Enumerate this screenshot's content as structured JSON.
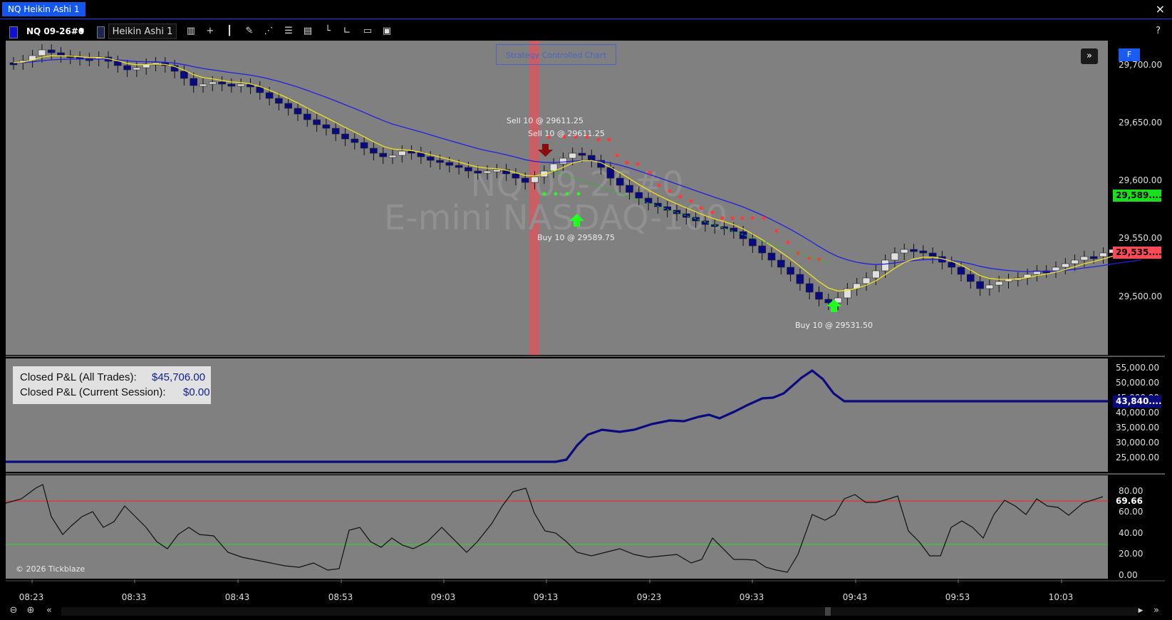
{
  "window": {
    "title": "NQ Heikin Ashi 1",
    "close_glyph": "×"
  },
  "toolbar": {
    "symbol": "NQ 09-26#0",
    "symbol_color": "#1010d0",
    "chart_type": "Heikin Ashi 1",
    "tools": [
      "bar-chart-icon",
      "crosshair-icon",
      "candles-icon",
      "pencil-icon",
      "trend-line-icon",
      "list-icon",
      "document-icon",
      "axis-icon",
      "axis-alt-icon",
      "folder-icon",
      "save-icon"
    ],
    "help": "?"
  },
  "chart": {
    "watermark_line1": "NQ 09-26#0",
    "watermark_line2": "E-mini NASDAQ-100",
    "strategy_label": "Strategy Controlled Chart",
    "f_button": "F",
    "price_axis": [
      "29,700.00",
      "29,650.00",
      "29,600.00",
      "29,550.00",
      "29,500.00"
    ],
    "tags": [
      {
        "text": "29,589....",
        "bg": "#19e019",
        "fg": "#000"
      },
      {
        "text": "29,535....",
        "bg": "#ff4a55",
        "fg": "#000"
      }
    ],
    "trades": [
      {
        "text": "Sell 10 @ 29611.25"
      },
      {
        "text": "Sell 10 @ 29611.25"
      },
      {
        "text": "Buy 10 @ 29589.75"
      },
      {
        "text": "Buy 10 @ 29531.50"
      }
    ]
  },
  "pnl": {
    "label_all": "Closed P&L (All Trades):",
    "value_all": "$45,706.00",
    "label_session": "Closed P&L (Current Session):",
    "value_session": "$0.00",
    "axis": [
      "55,000.00",
      "50,000.00",
      "45,000.00",
      "40,000.00",
      "35,000.00",
      "30,000.00",
      "25,000.00"
    ],
    "tag": {
      "text": "43,840....",
      "bg": "#0a0a80",
      "fg": "#fff"
    }
  },
  "oscillator": {
    "axis": [
      "80.00",
      "60.00",
      "40.00",
      "20.00",
      "0.00"
    ],
    "tag": "69.66",
    "copyright": "© 2026 Tickblaze"
  },
  "time_axis": [
    "08:23",
    "08:33",
    "08:43",
    "08:53",
    "09:03",
    "09:13",
    "09:23",
    "09:33",
    "09:43",
    "09:53",
    "10:03"
  ],
  "colors": {
    "panel_bg": "#808080",
    "up": "#e0e0e0",
    "down": "#0a0a80",
    "ema_fast": "#f0e020",
    "ema_slow": "#2020e0"
  }
}
